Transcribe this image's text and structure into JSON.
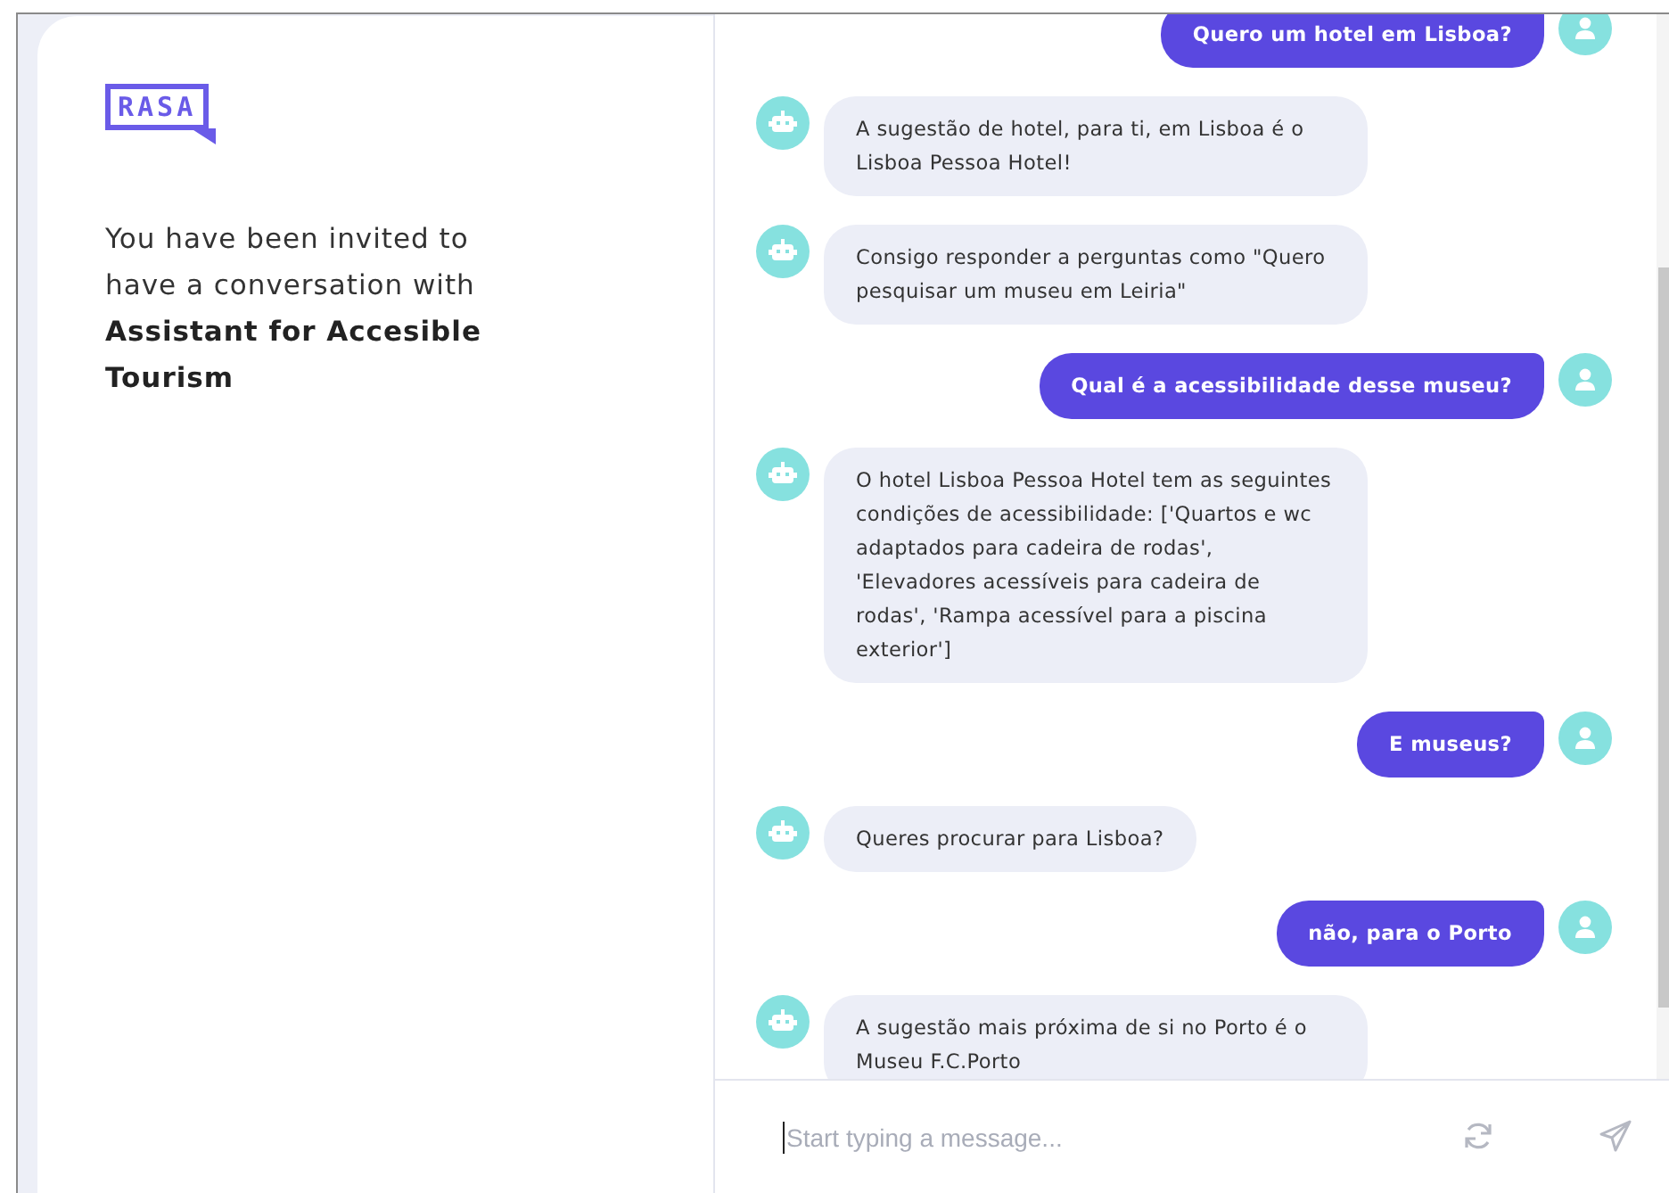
{
  "logo": {
    "text": "RASA"
  },
  "intro": "You have been invited to have a conversation with **Assistant for Accesible Tourism**",
  "messages": [
    {
      "kind": "user",
      "text": "Quero um hotel em Lisboa?"
    },
    {
      "kind": "bot",
      "text": "A sugestão de hotel, para ti, em Lisboa é o Lisboa Pessoa Hotel!"
    },
    {
      "kind": "bot",
      "text": "Consigo responder a perguntas como \"Quero pesquisar um museu em Leiria\""
    },
    {
      "kind": "user",
      "text": "Qual é a acessibilidade desse museu?"
    },
    {
      "kind": "bot",
      "text": "O hotel Lisboa Pessoa Hotel tem as seguintes condições de acessibilidade: ['Quartos e wc adaptados para cadeira de rodas', 'Elevadores acessíveis para cadeira de rodas', 'Rampa acessível para a piscina exterior']"
    },
    {
      "kind": "user",
      "text": "E museus?"
    },
    {
      "kind": "bot",
      "text": "Queres procurar para Lisboa?"
    },
    {
      "kind": "user",
      "text": "não, para o Porto"
    },
    {
      "kind": "bot",
      "text": "A sugestão mais próxima de si no Porto é o Museu F.C.Porto"
    }
  ],
  "composer": {
    "placeholder": "Start typing a message..."
  }
}
